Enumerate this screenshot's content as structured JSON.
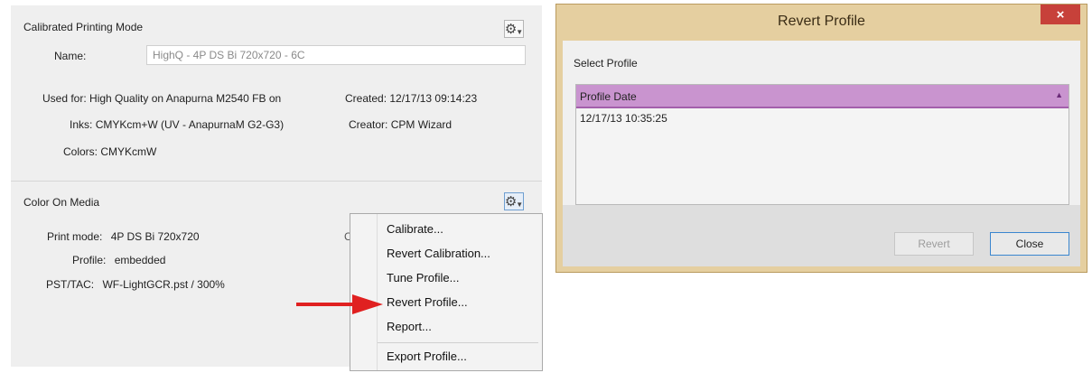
{
  "cpm": {
    "title": "Calibrated Printing Mode",
    "name_label": "Name:",
    "name_value": "HighQ - 4P DS Bi 720x720 - 6C",
    "used_for_label": "Used for:",
    "used_for_value": "High Quality on Anapurna M2540 FB on",
    "inks_label": "Inks:",
    "inks_value": "CMYKcm+W (UV - AnapurnaM G2-G3)",
    "colors_label": "Colors:",
    "colors_value": "CMYKcmW",
    "created_label": "Created:",
    "created_value": "12/17/13 09:14:23",
    "creator_label": "Creator:",
    "creator_value": "CPM Wizard"
  },
  "com": {
    "title": "Color On Media",
    "print_mode_label": "Print mode:",
    "print_mode_value": "4P DS Bi 720x720",
    "profile_label": "Profile:",
    "profile_value": "embedded",
    "pst_label": "PST/TAC:",
    "pst_value": "WF-LightGCR.pst /  300%",
    "clipped_char": "C"
  },
  "context_menu": {
    "items": [
      "Calibrate...",
      "Revert Calibration...",
      "Tune Profile...",
      "Revert Profile...",
      "Report...",
      "Export Profile..."
    ]
  },
  "icons": {
    "gear": "gear-icon",
    "arrow": "red-arrow-icon"
  },
  "dialog": {
    "title": "Revert Profile",
    "close_glyph": "×",
    "select_label": "Select Profile",
    "column_header": "Profile Date",
    "sort_glyph": "▲",
    "rows": [
      "12/17/13 10:35:25"
    ],
    "revert_button": "Revert",
    "close_button": "Close"
  },
  "colors": {
    "dialog_frame": "#e5cfa0",
    "close_red": "#c7413a",
    "list_header": "#c994cf",
    "arrow_red": "#e02020"
  }
}
